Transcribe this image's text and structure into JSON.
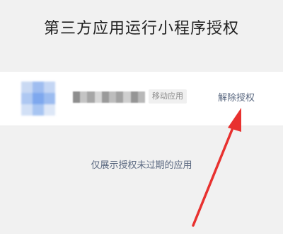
{
  "page": {
    "title": "第三方应用运行小程序授权",
    "hint": "仅展示授权未过期的应用"
  },
  "app_item": {
    "name": "",
    "tag": "移动应用",
    "revoke_label": "解除授权"
  },
  "colors": {
    "background": "#f1f1f1",
    "card": "#ffffff",
    "link": "#5a6880",
    "arrow": "#e8312f"
  }
}
